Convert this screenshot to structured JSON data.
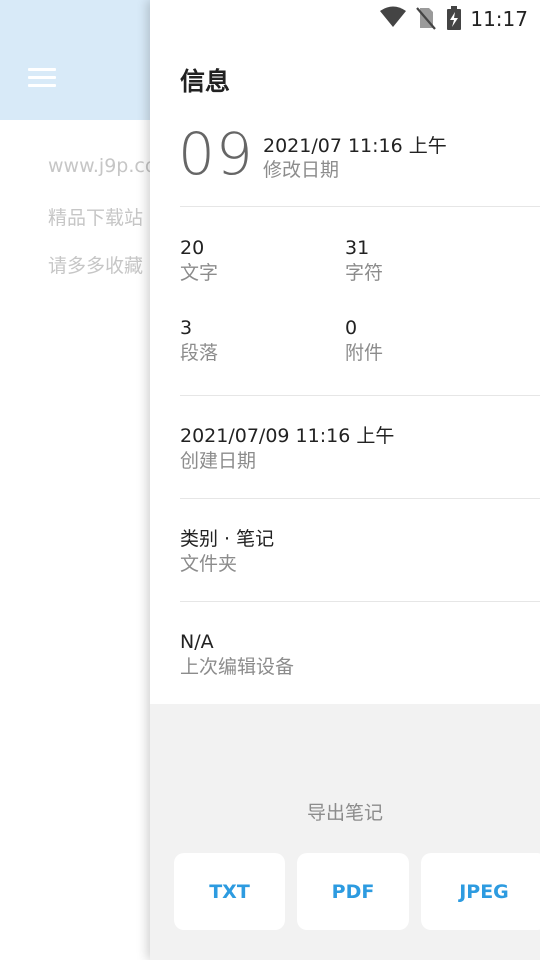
{
  "background": {
    "lines": [
      "www.j9p.co",
      "精品下载站",
      "请多多收藏"
    ]
  },
  "status_bar": {
    "time": "11:17",
    "icons": [
      "wifi-icon",
      "no-sim-icon",
      "battery-charging-icon"
    ]
  },
  "drawer": {
    "title": "信息",
    "day": "09",
    "modified": {
      "value": "2021/07 11:16 上午",
      "label": "修改日期"
    },
    "stats": {
      "words": {
        "value": "20",
        "label": "文字"
      },
      "chars": {
        "value": "31",
        "label": "字符"
      },
      "paragraphs": {
        "value": "3",
        "label": "段落"
      },
      "attachments": {
        "value": "0",
        "label": "附件"
      }
    },
    "created": {
      "value": "2021/07/09 11:16 上午",
      "label": "创建日期"
    },
    "folder": {
      "value": "类别 · 笔记",
      "label": "文件夹"
    },
    "device": {
      "value": "N/A",
      "label": "上次编辑设备"
    }
  },
  "export": {
    "title": "导出笔记",
    "buttons": {
      "txt": "TXT",
      "pdf": "PDF",
      "jpeg": "JPEG"
    }
  },
  "colors": {
    "accent": "#2d9be0",
    "topbar": "#d8eaf8",
    "export_bg": "#f2f2f2"
  }
}
